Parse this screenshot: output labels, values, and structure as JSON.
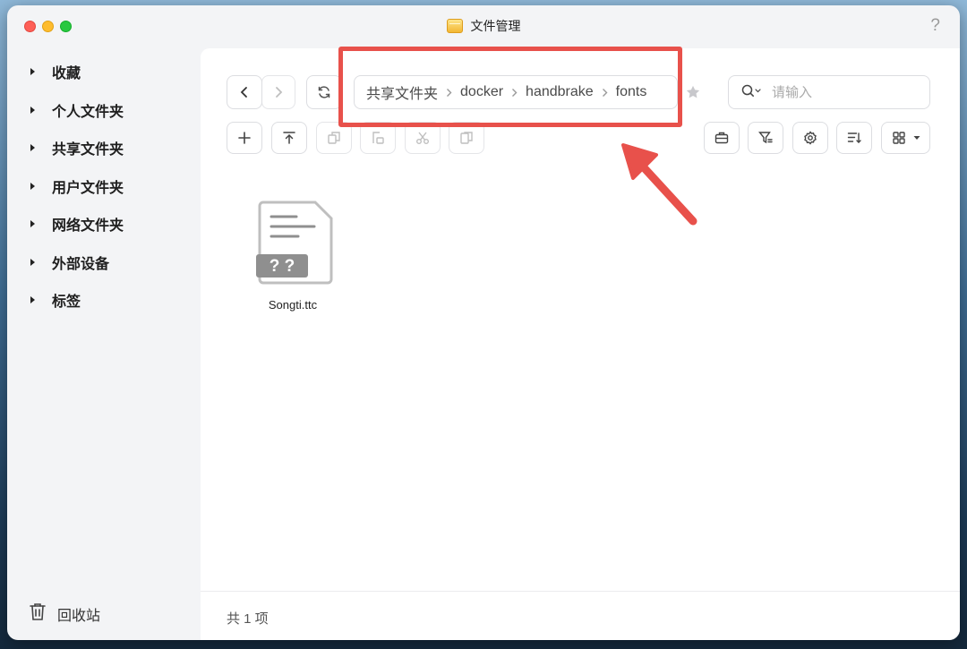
{
  "window": {
    "title": "文件管理",
    "help": "?"
  },
  "sidebar": {
    "items": [
      {
        "label": "收藏"
      },
      {
        "label": "个人文件夹"
      },
      {
        "label": "共享文件夹"
      },
      {
        "label": "用户文件夹"
      },
      {
        "label": "网络文件夹"
      },
      {
        "label": "外部设备"
      },
      {
        "label": "标签"
      }
    ],
    "recycle_label": "回收站"
  },
  "toolbar": {
    "breadcrumb": [
      "共享文件夹",
      "docker",
      "handbrake",
      "fonts"
    ],
    "search_placeholder": "请输入"
  },
  "files": [
    {
      "name": "Songti.ttc",
      "badge": "? ?"
    }
  ],
  "footer": {
    "count": "共 1 项"
  },
  "colors": {
    "annotation": "#e8514b",
    "traffic_red": "#fe5f57",
    "traffic_yellow": "#febc2e",
    "traffic_green": "#28c840"
  }
}
